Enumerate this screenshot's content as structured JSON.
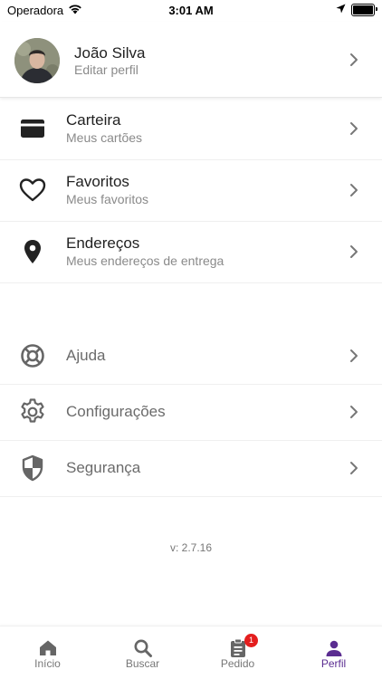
{
  "status_bar": {
    "carrier": "Operadora",
    "time": "3:01 AM"
  },
  "profile": {
    "name": "João Silva",
    "subtitle": "Editar perfil"
  },
  "menu_primary": [
    {
      "title": "Carteira",
      "subtitle": "Meus cartões",
      "icon": "wallet-card-icon"
    },
    {
      "title": "Favoritos",
      "subtitle": "Meus favoritos",
      "icon": "heart-icon"
    },
    {
      "title": "Endereços",
      "subtitle": "Meus endereços de entrega",
      "icon": "location-pin-icon"
    }
  ],
  "menu_secondary": [
    {
      "label": "Ajuda",
      "icon": "lifebuoy-icon"
    },
    {
      "label": "Configurações",
      "icon": "gear-icon"
    },
    {
      "label": "Segurança",
      "icon": "shield-icon"
    }
  ],
  "version": "v: 2.7.16",
  "tabbar": {
    "tabs": [
      {
        "label": "Início",
        "icon": "home-icon"
      },
      {
        "label": "Buscar",
        "icon": "search-icon"
      },
      {
        "label": "Pedido",
        "icon": "clipboard-icon",
        "badge": "1"
      },
      {
        "label": "Perfil",
        "icon": "person-icon",
        "active": true
      }
    ]
  },
  "colors": {
    "accent": "#5b2d91",
    "badge": "#e41e1e",
    "muted": "#8a8a8a"
  }
}
